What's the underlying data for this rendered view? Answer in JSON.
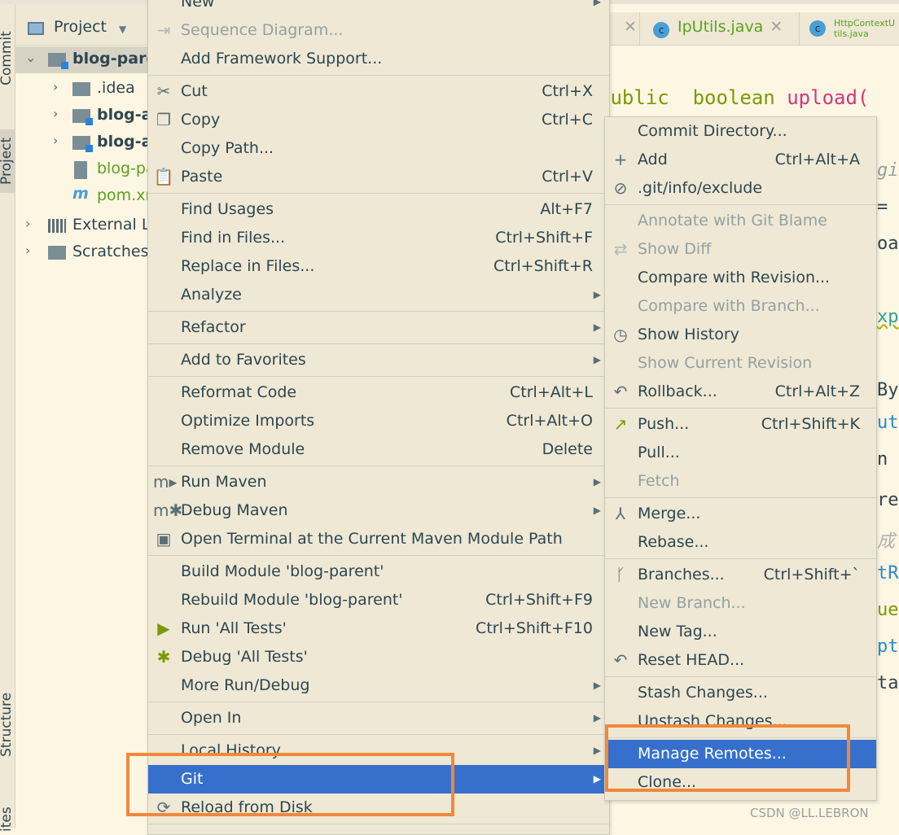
{
  "sidebar": {
    "commit_label": "Commit",
    "project_label": "Project",
    "structure_label": "Structure",
    "favorites_label": "ites"
  },
  "project_panel": {
    "title": "Project",
    "tree": [
      {
        "label": "blog-parent",
        "kind": "module",
        "bold": true,
        "expanded": true,
        "selected": true
      },
      {
        "label": ".idea",
        "kind": "folder"
      },
      {
        "label": "blog-api",
        "kind": "module",
        "bold": true
      },
      {
        "label": "blog-admin",
        "kind": "module",
        "bold": true
      },
      {
        "label": "blog-parent.iml",
        "kind": "iml",
        "green": true
      },
      {
        "label": "pom.xml",
        "kind": "maven",
        "green": true
      },
      {
        "label": "External Libraries",
        "kind": "libs"
      },
      {
        "label": "Scratches and Consoles",
        "kind": "scratches"
      }
    ]
  },
  "editor": {
    "tabs": [
      {
        "label": "IpUtils.java"
      },
      {
        "label": "HttpContextUtils.java"
      }
    ],
    "code_line": {
      "kw1": "public",
      "kw2": "boolean",
      "fn": "upload("
    },
    "fragments": [
      "gi",
      "=",
      "oa",
      "xp",
      "By",
      "ut",
      "n",
      "re",
      "成",
      "tR",
      "ue",
      "pt",
      "ta"
    ]
  },
  "context_menu": {
    "items": [
      {
        "label": "New",
        "sub": true
      },
      {
        "label": "Sequence Diagram...",
        "icon": "sequence-diagram-icon",
        "glyph": "⇥",
        "disabled": true
      },
      {
        "label": "Add Framework Support..."
      },
      {
        "sep": true
      },
      {
        "label": "Cut",
        "icon": "scissors-icon",
        "glyph": "✂",
        "shortcut": "Ctrl+X"
      },
      {
        "label": "Copy",
        "icon": "copy-icon",
        "glyph": "❐",
        "shortcut": "Ctrl+C"
      },
      {
        "label": "Copy Path..."
      },
      {
        "label": "Paste",
        "icon": "clipboard-icon",
        "glyph": "📋",
        "shortcut": "Ctrl+V"
      },
      {
        "sep": true
      },
      {
        "label": "Find Usages",
        "shortcut": "Alt+F7"
      },
      {
        "label": "Find in Files...",
        "shortcut": "Ctrl+Shift+F"
      },
      {
        "label": "Replace in Files...",
        "shortcut": "Ctrl+Shift+R"
      },
      {
        "label": "Analyze",
        "sub": true
      },
      {
        "sep": true
      },
      {
        "label": "Refactor",
        "sub": true
      },
      {
        "sep": true
      },
      {
        "label": "Add to Favorites",
        "sub": true
      },
      {
        "sep": true
      },
      {
        "label": "Reformat Code",
        "shortcut": "Ctrl+Alt+L"
      },
      {
        "label": "Optimize Imports",
        "shortcut": "Ctrl+Alt+O"
      },
      {
        "label": "Remove Module",
        "shortcut": "Delete"
      },
      {
        "sep": true
      },
      {
        "label": "Run Maven",
        "icon": "maven-run-icon",
        "glyph": "m▸",
        "sub": true
      },
      {
        "label": "Debug Maven",
        "icon": "maven-debug-icon",
        "glyph": "m✱",
        "sub": true
      },
      {
        "label": "Open Terminal at the Current Maven Module Path",
        "icon": "terminal-maven-icon",
        "glyph": "▣"
      },
      {
        "sep": true
      },
      {
        "label": "Build Module 'blog-parent'"
      },
      {
        "label": "Rebuild Module 'blog-parent'",
        "shortcut": "Ctrl+Shift+F9"
      },
      {
        "label": "Run 'All Tests'",
        "icon": "run-icon",
        "glyph": "▶",
        "color": "#7a9a01",
        "shortcut": "Ctrl+Shift+F10"
      },
      {
        "label": "Debug 'All Tests'",
        "icon": "debug-bug-icon",
        "glyph": "✱",
        "color": "#7a9a01"
      },
      {
        "label": "More Run/Debug",
        "sub": true
      },
      {
        "sep": true
      },
      {
        "label": "Open In",
        "sub": true
      },
      {
        "sep": true
      },
      {
        "label": "Local History",
        "sub": true
      },
      {
        "label": "Git",
        "sub": true,
        "highlighted": true
      },
      {
        "label": "Reload from Disk",
        "icon": "reload-icon",
        "glyph": "⟳"
      },
      {
        "sep": true
      }
    ]
  },
  "git_submenu": {
    "items": [
      {
        "label": "Commit Directory..."
      },
      {
        "label": "Add",
        "icon": "plus-icon",
        "glyph": "+",
        "shortcut": "Ctrl+Alt+A"
      },
      {
        "label": ".git/info/exclude",
        "icon": "exclude-file-icon",
        "glyph": "⊘"
      },
      {
        "sep": true
      },
      {
        "label": "Annotate with Git Blame",
        "disabled": true
      },
      {
        "label": "Show Diff",
        "icon": "diff-icon",
        "glyph": "⇄",
        "disabled": true
      },
      {
        "label": "Compare with Revision..."
      },
      {
        "label": "Compare with Branch...",
        "disabled": true
      },
      {
        "label": "Show History",
        "icon": "clock-icon",
        "glyph": "◷"
      },
      {
        "label": "Show Current Revision",
        "disabled": true
      },
      {
        "label": "Rollback...",
        "icon": "rollback-icon",
        "glyph": "↶",
        "shortcut": "Ctrl+Alt+Z"
      },
      {
        "sep": true
      },
      {
        "label": "Push...",
        "icon": "push-arrow-icon",
        "glyph": "↗",
        "color": "#7a9a01",
        "shortcut": "Ctrl+Shift+K"
      },
      {
        "label": "Pull..."
      },
      {
        "label": "Fetch",
        "disabled": true
      },
      {
        "sep": true
      },
      {
        "label": "Merge...",
        "icon": "merge-icon",
        "glyph": "⅄"
      },
      {
        "label": "Rebase..."
      },
      {
        "sep": true
      },
      {
        "label": "Branches...",
        "icon": "branch-icon",
        "glyph": "ᚴ",
        "shortcut": "Ctrl+Shift+`"
      },
      {
        "label": "New Branch...",
        "disabled": true
      },
      {
        "label": "New Tag..."
      },
      {
        "label": "Reset HEAD...",
        "icon": "reset-icon",
        "glyph": "↶"
      },
      {
        "sep": true
      },
      {
        "label": "Stash Changes..."
      },
      {
        "label": "Unstash Changes..."
      },
      {
        "sep": true
      },
      {
        "label": "Manage Remotes...",
        "highlighted": true
      },
      {
        "label": "Clone..."
      }
    ]
  },
  "colors": {
    "highlight": "#3670cc",
    "annotation": "#f0883a",
    "menu_bg": "#eee8d5",
    "editor_bg": "#fdf6e3"
  },
  "watermark": "CSDN @LL.LEBRON"
}
